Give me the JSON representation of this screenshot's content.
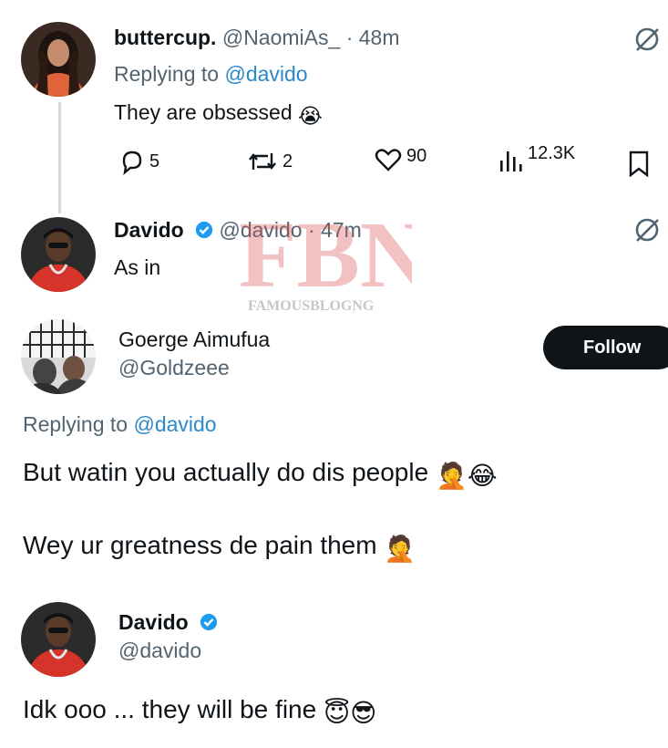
{
  "reply1": {
    "display_name": "buttercup.",
    "handle": "@NaomiAs_",
    "time": "· 48m",
    "replying_prefix": "Replying to",
    "replying_handle": "@davido",
    "text": "They are obsessed",
    "emoji": "😭",
    "stats": {
      "replies": "5",
      "reposts": "2",
      "likes": "90",
      "views": "12.3K"
    }
  },
  "reply2": {
    "display_name": "Davido",
    "handle": "@davido",
    "time": "· 47m",
    "text": "As in"
  },
  "watermark": {
    "letters": "FBN",
    "caption": "FAMOUSBLOGNG"
  },
  "main_tweet": {
    "display_name": "Goerge Aimufua",
    "handle": "@Goldzeee",
    "follow_label": "Follow",
    "replying_prefix": "Replying to",
    "replying_handle": "@davido",
    "line1": "But watin you actually do dis people",
    "line1_emoji": "🤦😂",
    "line2": "Wey ur greatness de pain them",
    "line2_emoji": "🤦"
  },
  "response": {
    "display_name": "Davido",
    "handle": "@davido",
    "text": "Idk ooo ... they will be fine",
    "emoji": "😇😎"
  },
  "colors": {
    "verified": "#1d9bf0",
    "link": "#2b88c9",
    "muted": "#536471",
    "follow_bg": "#0f1419",
    "watermark": "#d94a4a"
  },
  "icons": [
    "grok-icon",
    "reply-icon",
    "repost-icon",
    "like-icon",
    "views-icon",
    "bookmark-icon",
    "verified-badge-icon"
  ]
}
